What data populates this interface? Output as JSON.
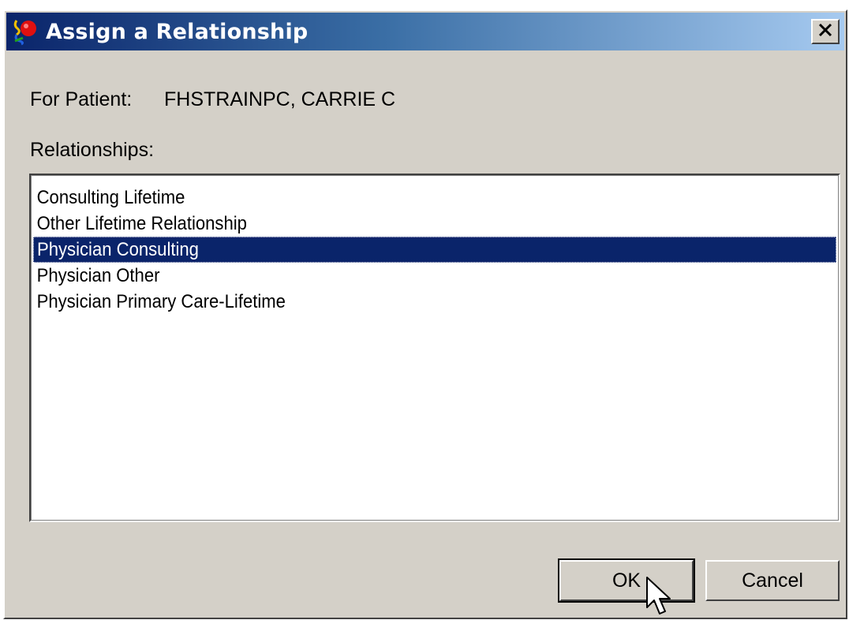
{
  "window": {
    "title": "Assign a Relationship",
    "close_symbol": "×"
  },
  "patient": {
    "label": "For Patient:",
    "name": "FHSTRAINPC, CARRIE C"
  },
  "relationships": {
    "label": "Relationships:",
    "items": [
      "Consulting Lifetime",
      "Other Lifetime Relationship",
      "Physician Consulting",
      "Physician Other",
      "Physician Primary Care-Lifetime"
    ],
    "selected_index": 2,
    "selected_value": "Physician Consulting"
  },
  "buttons": {
    "ok_label": "OK",
    "cancel_label": "Cancel"
  },
  "colors": {
    "selection": "#0a246a",
    "dialog_face": "#d4d0c8",
    "title_gradient_start": "#0a246a",
    "title_gradient_end": "#a6caf0"
  },
  "icons": {
    "app": "app-icon",
    "close": "close-icon",
    "cursor": "mouse-pointer-icon"
  }
}
